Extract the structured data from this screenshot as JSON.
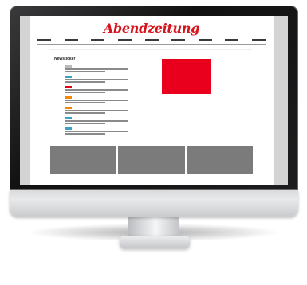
{
  "site": {
    "logo": "Abendzeitung",
    "accent_color": "#e8001c"
  },
  "nav": {
    "items": [
      "",
      "",
      "",
      "",
      "",
      "",
      "",
      "",
      ""
    ]
  },
  "newsticker": {
    "title": "Newsticker :",
    "items": [
      {
        "tag_color": "#bbbbbb"
      },
      {
        "tag_color": "#3aa0c8"
      },
      {
        "tag_color": "#e0001a"
      },
      {
        "tag_color": "#f08a00"
      },
      {
        "tag_color": "#f08a00"
      },
      {
        "tag_color": "#3aa0c8"
      },
      {
        "tag_color": "#3aa0c8"
      }
    ]
  },
  "teasers": {
    "colors": [
      "#7b7b7b",
      "#7b7b7b",
      "#7b7b7b"
    ]
  }
}
